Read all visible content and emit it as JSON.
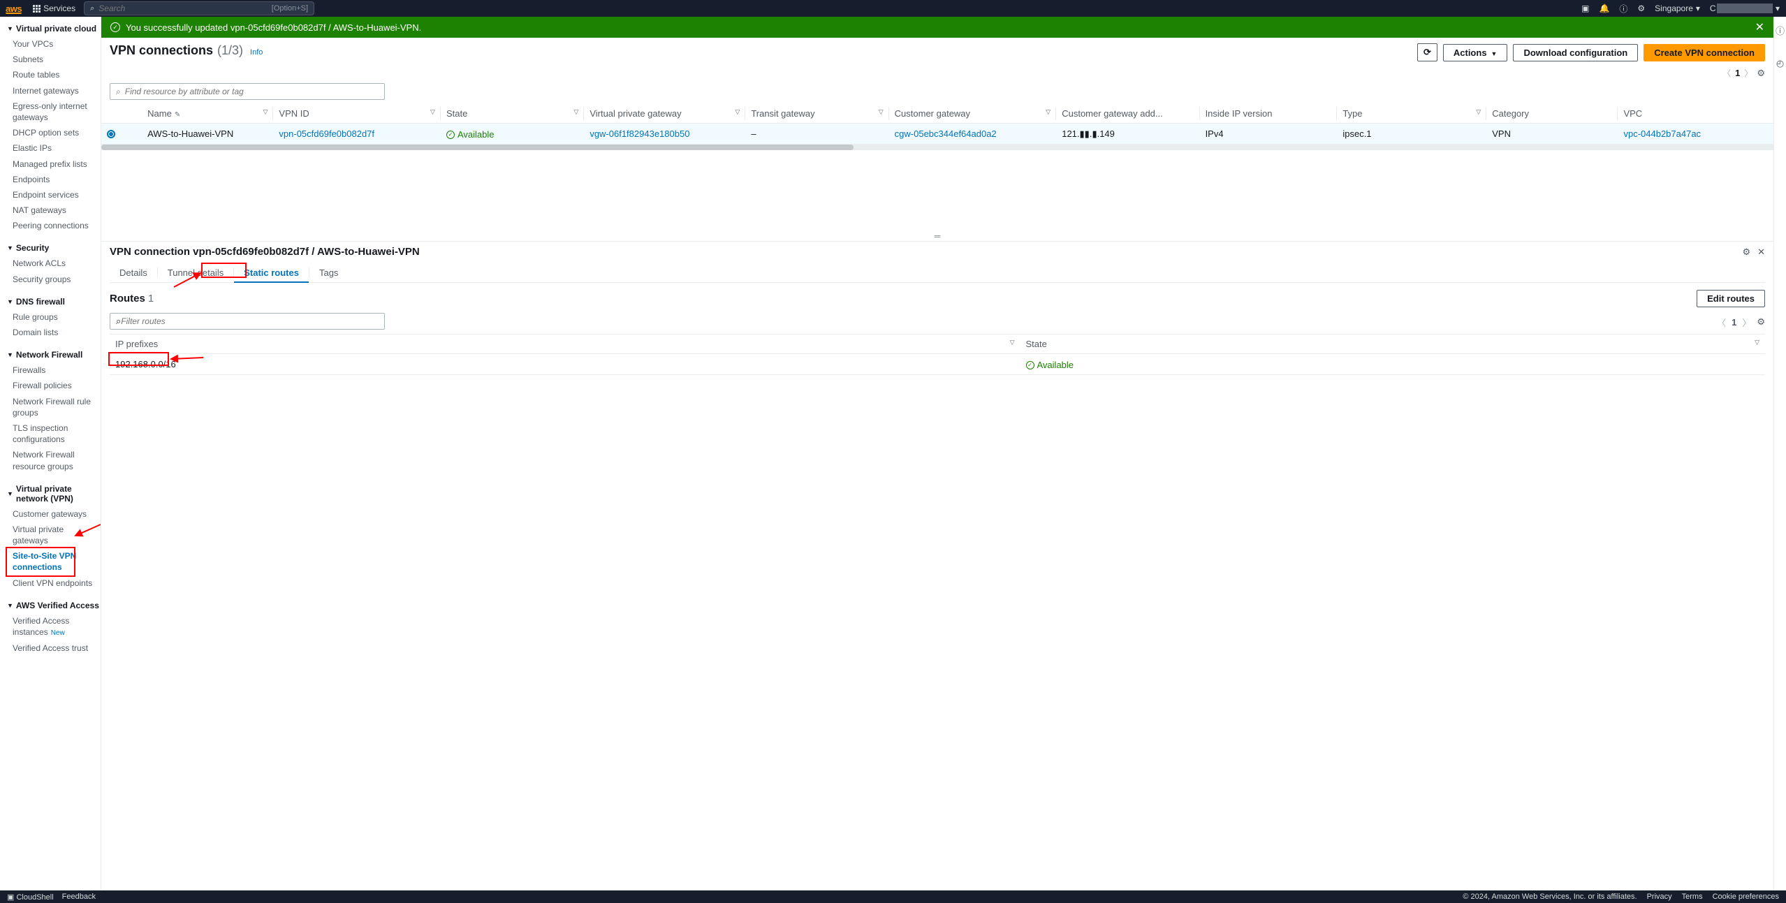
{
  "topnav": {
    "services": "Services",
    "search_placeholder": "Search",
    "search_shortcut": "[Option+S]",
    "region": "Singapore",
    "account_prefix": "C"
  },
  "sidebar": {
    "groups": [
      {
        "title": "Virtual private cloud",
        "items": [
          "Your VPCs",
          "Subnets",
          "Route tables",
          "Internet gateways",
          "Egress-only internet gateways",
          "DHCP option sets",
          "Elastic IPs",
          "Managed prefix lists",
          "Endpoints",
          "Endpoint services",
          "NAT gateways",
          "Peering connections"
        ]
      },
      {
        "title": "Security",
        "items": [
          "Network ACLs",
          "Security groups"
        ]
      },
      {
        "title": "DNS firewall",
        "items": [
          "Rule groups",
          "Domain lists"
        ]
      },
      {
        "title": "Network Firewall",
        "items": [
          "Firewalls",
          "Firewall policies",
          "Network Firewall rule groups",
          "TLS inspection configurations",
          "Network Firewall resource groups"
        ]
      },
      {
        "title": "Virtual private network (VPN)",
        "items": [
          "Customer gateways",
          "Virtual private gateways",
          "Site-to-Site VPN connections",
          "Client VPN endpoints"
        ]
      },
      {
        "title": "AWS Verified Access",
        "items": [
          "Verified Access instances",
          "Verified Access trust"
        ]
      }
    ],
    "active_item": "Site-to-Site VPN connections",
    "new_badge_item": "Verified Access instances",
    "new_badge_label": "New"
  },
  "banner": {
    "message": "You successfully updated vpn-05cfd69fe0b082d7f / AWS-to-Huawei-VPN."
  },
  "page": {
    "title": "VPN connections",
    "count": "(1/3)",
    "info": "Info",
    "actions": "Actions",
    "download": "Download configuration",
    "create": "Create VPN connection",
    "filter_placeholder": "Find resource by attribute or tag",
    "page_num": "1"
  },
  "columns": [
    "Name",
    "VPN ID",
    "State",
    "Virtual private gateway",
    "Transit gateway",
    "Customer gateway",
    "Customer gateway add...",
    "Inside IP version",
    "Type",
    "Category",
    "VPC"
  ],
  "row": {
    "name": "AWS-to-Huawei-VPN",
    "vpn_id": "vpn-05cfd69fe0b082d7f",
    "state": "Available",
    "vgw": "vgw-06f1f82943e180b50",
    "tgw": "–",
    "cgw": "cgw-05ebc344ef64ad0a2",
    "cgw_addr": "121.▮▮.▮.149",
    "inside_ip": "IPv4",
    "type": "ipsec.1",
    "category": "VPN",
    "vpc": "vpc-044b2b7a47ac"
  },
  "details": {
    "title": "VPN connection vpn-05cfd69fe0b082d7f / AWS-to-Huawei-VPN",
    "tabs": [
      "Details",
      "Tunnel details",
      "Static routes",
      "Tags"
    ],
    "active_tab": "Static routes",
    "routes_title": "Routes",
    "routes_count": "1",
    "edit_routes": "Edit routes",
    "filter_placeholder": "Filter routes",
    "page_num": "1",
    "cols": [
      "IP prefixes",
      "State"
    ],
    "route": {
      "prefix": "192.168.0.0/16",
      "state": "Available"
    }
  },
  "footer": {
    "cloudshell": "CloudShell",
    "feedback": "Feedback",
    "copyright": "© 2024, Amazon Web Services, Inc. or its affiliates.",
    "privacy": "Privacy",
    "terms": "Terms",
    "cookie": "Cookie preferences"
  }
}
